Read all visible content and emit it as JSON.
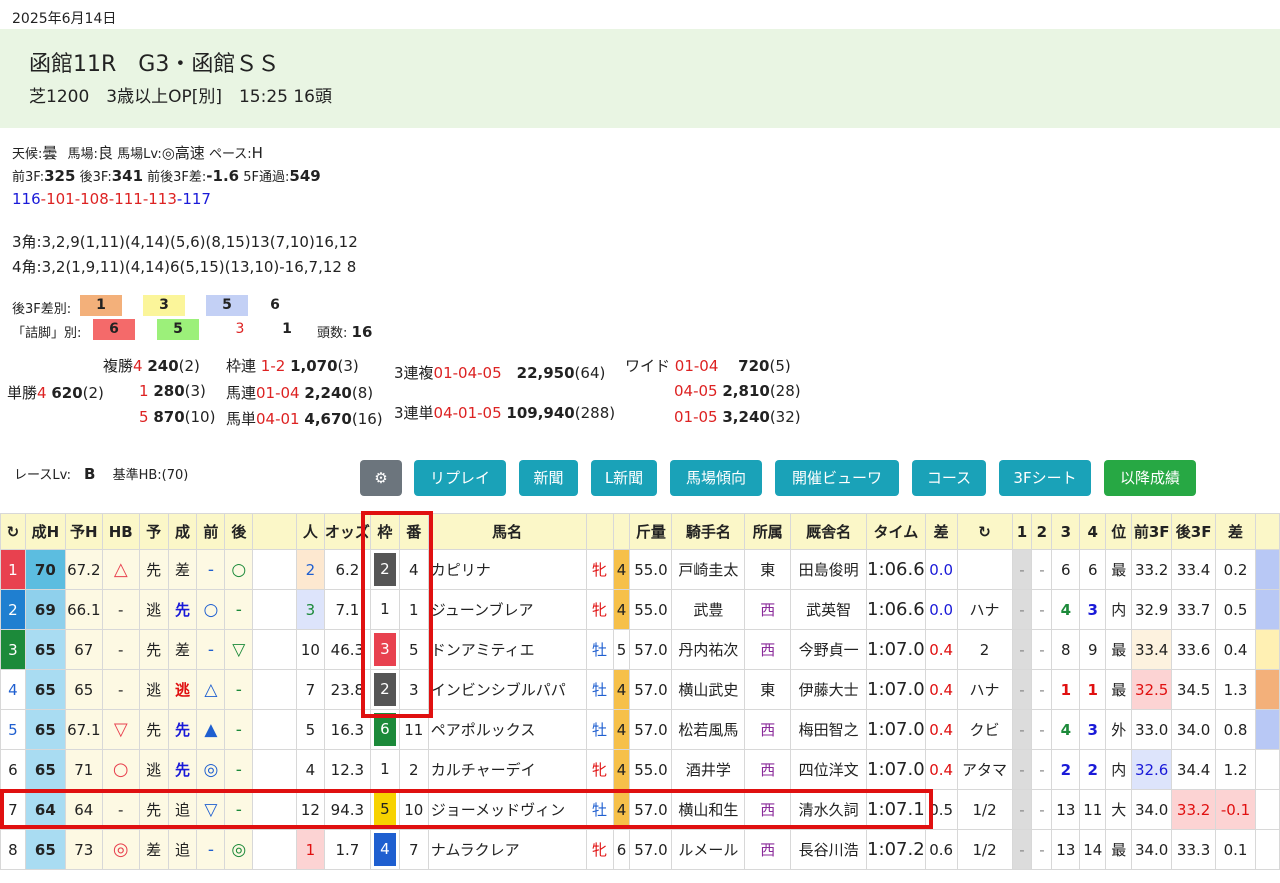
{
  "date": "2025年6月14日",
  "race": {
    "title": "函館11R　G3・函館ＳＳ",
    "sub": "芝1200　3歳以上OP[別]　15:25 16頭"
  },
  "info": {
    "weather_label": "天候:",
    "weather": "曇",
    "track_label": "馬場:",
    "track": "良",
    "lv_label": "馬場Lv:",
    "lv": "◎高速",
    "pace_label": "ペース:",
    "pace": "H",
    "f3_label": "前3F:",
    "f3": "325",
    "l3_label": "後3F:",
    "l3": "341",
    "diff_label": "前後3F差:",
    "diff": "-1.6",
    "f5_label": "5F通過:",
    "f5": "549",
    "laps": [
      "116",
      "101",
      "108",
      "111",
      "113",
      "117"
    ],
    "corner3": "3角:3,2,9(1,11)(4,14)(5,6)(8,15)13(7,10)16,12",
    "corner4": "4角:3,2(1,9,11)(4,14)6(5,15)(13,10)-16,7,12 8"
  },
  "sabetsu": {
    "label1": "後3F差別:",
    "c1": "1",
    "c2": "3",
    "c3": "5",
    "c4": "6",
    "label2": "「詰脚」別:",
    "d1": "6",
    "d2": "5",
    "d3": "3",
    "d4": "1",
    "heads_label": "頭数:",
    "heads": "16"
  },
  "payouts": {
    "fukusho_label": "複勝",
    "tansho_label": "単勝",
    "tansho": "4",
    "tansho_val": "620",
    "tansho_pop": "(2)",
    "fuku": [
      {
        "no": "4",
        "val": "240",
        "pop": "(2)"
      },
      {
        "no": "1",
        "val": "280",
        "pop": "(3)"
      },
      {
        "no": "5",
        "val": "870",
        "pop": "(10)"
      }
    ],
    "wakuren_label": "枠連",
    "wakuren": "1-2",
    "wakuren_val": "1,070",
    "wakuren_pop": "(3)",
    "umaren_label": "馬連",
    "umaren": "01-04",
    "umaren_val": "2,240",
    "umaren_pop": "(8)",
    "umatan_label": "馬単",
    "umatan": "04-01",
    "umatan_val": "4,670",
    "umatan_pop": "(16)",
    "sanrenpuku_label": "3連複",
    "sanrenpuku": "01-04-05",
    "sanrenpuku_val": "22,950",
    "sanrenpuku_pop": "(64)",
    "sanrentan_label": "3連単",
    "sanrentan": "04-01-05",
    "sanrentan_val": "109,940",
    "sanrentan_pop": "(288)",
    "wide_label": "ワイド",
    "wide": [
      {
        "no": "01-04",
        "val": "720",
        "pop": "(5)"
      },
      {
        "no": "04-05",
        "val": "2,810",
        "pop": "(28)"
      },
      {
        "no": "01-05",
        "val": "3,240",
        "pop": "(32)"
      }
    ]
  },
  "racelv": {
    "label": "レースLv:",
    "value": "B",
    "hb_label": "基準HB:",
    "hb": "(70)"
  },
  "buttons": [
    "リプレイ",
    "新聞",
    "L新聞",
    "馬場傾向",
    "開催ビューワ",
    "コース",
    "3Fシート",
    "以降成績"
  ],
  "headers": [
    "↻",
    "成H",
    "予H",
    "HB",
    "予",
    "成",
    "前",
    "後",
    "",
    "人",
    "オッズ",
    "枠",
    "番",
    "馬名",
    "",
    "",
    "斤量",
    "騎手名",
    "所属",
    "厩舎名",
    "タイム",
    "差",
    "↻",
    "1",
    "2",
    "3",
    "4",
    "位",
    "前3F",
    "後3F",
    "差",
    ""
  ],
  "rows": [
    {
      "rank": "1",
      "seih": "70",
      "yoh": "67.2",
      "hb": "△",
      "yo": "先",
      "sei": "差",
      "mae": "-",
      "ato": "○",
      "pop": "2",
      "odds": "6.2",
      "waku": "2",
      "ban": "4",
      "name": "カピリナ",
      "sex": "牝",
      "age": "4",
      "kin": "55.0",
      "jockey": "戸崎圭太",
      "shozoku": "東",
      "trainer": "田島俊明",
      "time": "1:06.6",
      "sa": "0.0",
      "note": "",
      "c1": "-",
      "c2": "-",
      "c3": "6",
      "c4": "6",
      "pos": "最",
      "f3": "33.2",
      "l3": "33.4",
      "d": "0.2"
    },
    {
      "rank": "2",
      "seih": "69",
      "yoh": "66.1",
      "hb": "-",
      "yo": "逃",
      "sei": "先",
      "mae": "○",
      "ato": "-",
      "pop": "3",
      "odds": "7.1",
      "waku": "1",
      "ban": "1",
      "name": "ジューンブレア",
      "sex": "牝",
      "age": "4",
      "kin": "55.0",
      "jockey": "武豊",
      "shozoku": "西",
      "trainer": "武英智",
      "time": "1:06.6",
      "sa": "0.0",
      "note": "ハナ",
      "c1": "-",
      "c2": "-",
      "c3": "4",
      "c4": "3",
      "pos": "内",
      "f3": "32.9",
      "l3": "33.7",
      "d": "0.5"
    },
    {
      "rank": "3",
      "seih": "65",
      "yoh": "67",
      "hb": "-",
      "yo": "先",
      "sei": "差",
      "mae": "-",
      "ato": "▽",
      "pop": "10",
      "odds": "46.3",
      "waku": "3",
      "ban": "5",
      "name": "ドンアミティエ",
      "sex": "牡",
      "age": "5",
      "kin": "57.0",
      "jockey": "丹内祐次",
      "shozoku": "西",
      "trainer": "今野貞一",
      "time": "1:07.0",
      "sa": "0.4",
      "note": "2",
      "c1": "-",
      "c2": "-",
      "c3": "8",
      "c4": "9",
      "pos": "最",
      "f3": "33.4",
      "l3": "33.6",
      "d": "0.4"
    },
    {
      "rank": "4",
      "seih": "65",
      "yoh": "65",
      "hb": "-",
      "yo": "逃",
      "sei": "逃",
      "mae": "△",
      "ato": "-",
      "pop": "7",
      "odds": "23.8",
      "waku": "2",
      "ban": "3",
      "name": "インビンシブルパパ",
      "sex": "牡",
      "age": "4",
      "kin": "57.0",
      "jockey": "横山武史",
      "shozoku": "東",
      "trainer": "伊藤大士",
      "time": "1:07.0",
      "sa": "0.4",
      "note": "ハナ",
      "c1": "-",
      "c2": "-",
      "c3": "1",
      "c4": "1",
      "pos": "最",
      "f3": "32.5",
      "l3": "34.5",
      "d": "1.3"
    },
    {
      "rank": "5",
      "seih": "65",
      "yoh": "67.1",
      "hb": "▽",
      "yo": "先",
      "sei": "先",
      "mae": "▲",
      "ato": "-",
      "pop": "5",
      "odds": "16.3",
      "waku": "6",
      "ban": "11",
      "name": "ペアポルックス",
      "sex": "牡",
      "age": "4",
      "kin": "57.0",
      "jockey": "松若風馬",
      "shozoku": "西",
      "trainer": "梅田智之",
      "time": "1:07.0",
      "sa": "0.4",
      "note": "クビ",
      "c1": "-",
      "c2": "-",
      "c3": "4",
      "c4": "3",
      "pos": "外",
      "f3": "33.0",
      "l3": "34.0",
      "d": "0.8"
    },
    {
      "rank": "6",
      "seih": "65",
      "yoh": "71",
      "hb": "○",
      "yo": "逃",
      "sei": "先",
      "mae": "◎",
      "ato": "-",
      "pop": "4",
      "odds": "12.3",
      "waku": "1",
      "ban": "2",
      "name": "カルチャーデイ",
      "sex": "牝",
      "age": "4",
      "kin": "55.0",
      "jockey": "酒井学",
      "shozoku": "西",
      "trainer": "四位洋文",
      "time": "1:07.0",
      "sa": "0.4",
      "note": "アタマ",
      "c1": "-",
      "c2": "-",
      "c3": "2",
      "c4": "2",
      "pos": "内",
      "f3": "32.6",
      "l3": "34.4",
      "d": "1.2"
    },
    {
      "rank": "7",
      "seih": "64",
      "yoh": "64",
      "hb": "-",
      "yo": "先",
      "sei": "追",
      "mae": "▽",
      "ato": "-",
      "pop": "12",
      "odds": "94.3",
      "waku": "5",
      "ban": "10",
      "name": "ジョーメッドヴィン",
      "sex": "牡",
      "age": "4",
      "kin": "57.0",
      "jockey": "横山和生",
      "shozoku": "西",
      "trainer": "清水久詞",
      "time": "1:07.1",
      "sa": "0.5",
      "note": "1/2",
      "c1": "-",
      "c2": "-",
      "c3": "13",
      "c4": "11",
      "pos": "大",
      "f3": "34.0",
      "l3": "33.2",
      "d": "-0.1"
    },
    {
      "rank": "8",
      "seih": "65",
      "yoh": "73",
      "hb": "◎",
      "yo": "差",
      "sei": "追",
      "mae": "-",
      "ato": "◎",
      "pop": "1",
      "odds": "1.7",
      "waku": "4",
      "ban": "7",
      "name": "ナムラクレア",
      "sex": "牝",
      "age": "6",
      "kin": "57.0",
      "jockey": "ルメール",
      "shozoku": "西",
      "trainer": "長谷川浩",
      "time": "1:07.2",
      "sa": "0.6",
      "note": "1/2",
      "c1": "-",
      "c2": "-",
      "c3": "13",
      "c4": "14",
      "pos": "最",
      "f3": "34.0",
      "l3": "33.3",
      "d": "0.1"
    }
  ],
  "colors": {
    "waku1": "#ffffff",
    "waku2": "#555555",
    "waku3": "#e8414f",
    "waku4": "#1f5fd0",
    "waku5": "#f7d200",
    "waku6": "#1c8a3a",
    "highlight": "#e01010",
    "header": "#fbf7c8"
  }
}
